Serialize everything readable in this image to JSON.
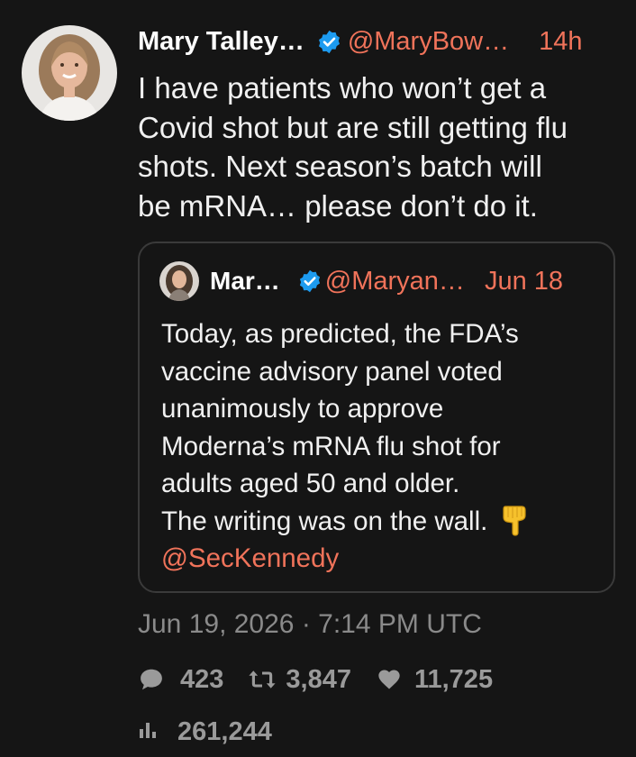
{
  "tweet": {
    "author_name": "Mary Talley…",
    "handle": "@MaryBow…",
    "time": "14h",
    "text": "I have patients who won’t get a\nCovid shot but are still getting flu\nshots. Next season’s batch will\nbe mRNA… please don’t do it."
  },
  "quote": {
    "author_name": "Mar…",
    "handle": "@Maryan…",
    "time": "Jun 18",
    "lines": [
      "Today, as predicted, the FDA’s",
      "vaccine advisory panel voted",
      "unanimously to approve",
      "Moderna’s mRNA flu shot for",
      "adults aged 50 and older.",
      "The writing was on the wall."
    ],
    "mention": "@SecKennedy",
    "emoji_icon": "backhand-index-pointing-down-icon"
  },
  "timestamp": "Jun 19, 2026 · 7:14 PM UTC",
  "stats": {
    "replies": "423",
    "retweets": "3,847",
    "likes": "11,725",
    "views": "261,244"
  },
  "colors": {
    "background": "#151515",
    "accent": "#f0735a",
    "verified": "#1d9bf0",
    "muted": "#9a9a9a"
  }
}
